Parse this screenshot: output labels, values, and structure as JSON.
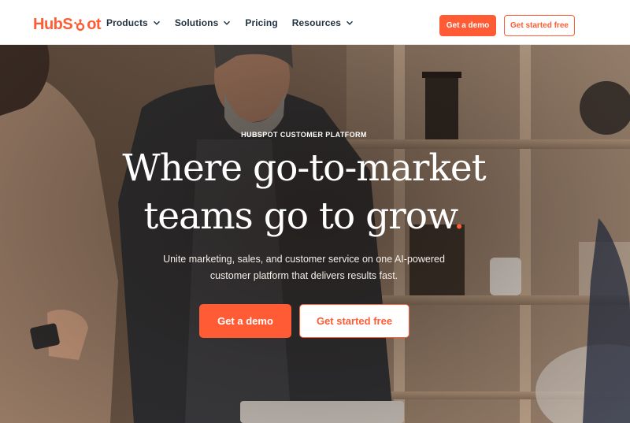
{
  "header": {
    "logo_text_left": "HubS",
    "logo_text_right": "ot",
    "nav": [
      {
        "label": "Products",
        "has_dropdown": true
      },
      {
        "label": "Solutions",
        "has_dropdown": true
      },
      {
        "label": "Pricing",
        "has_dropdown": false
      },
      {
        "label": "Resources",
        "has_dropdown": true
      }
    ],
    "demo_label": "Get a demo",
    "free_label": "Get started free"
  },
  "hero": {
    "eyebrow": "HUBSPOT CUSTOMER PLATFORM",
    "headline_line1": "Where go-to-market",
    "headline_line2": "teams go to grow",
    "headline_dot": ".",
    "subtext": "Unite marketing, sales, and customer service on one AI-powered customer platform that delivers results fast.",
    "demo_label": "Get a demo",
    "free_label": "Get started free"
  },
  "colors": {
    "brand": "#ff5c35",
    "nav_text": "#213343",
    "hero_text": "#ffffff"
  },
  "icons": {
    "logo": "hubspot-sprocket",
    "dropdown": "chevron-down-icon"
  }
}
